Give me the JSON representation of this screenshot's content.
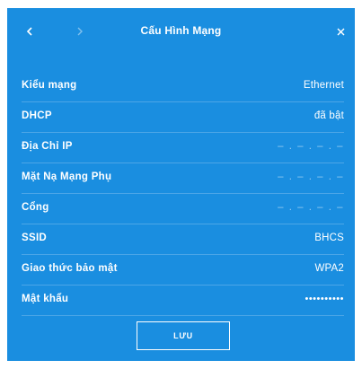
{
  "header": {
    "title": "Cấu Hình Mạng",
    "back_icon": "chevron-left-icon",
    "forward_icon": "chevron-right-icon",
    "close_icon": "close-icon"
  },
  "rows": [
    {
      "label": "Kiểu mạng",
      "value": "Ethernet"
    },
    {
      "label": "DHCP",
      "value": "đã bật"
    },
    {
      "label": "Địa Chỉ IP",
      "value": "– . – . – . –"
    },
    {
      "label": "Mặt Nạ Mạng Phụ",
      "value": "– . – . – . –"
    },
    {
      "label": "Cổng",
      "value": "– . – . – . –"
    },
    {
      "label": "SSID",
      "value": "BHCS"
    },
    {
      "label": "Giao thức bảo mật",
      "value": "WPA2"
    },
    {
      "label": "Mật khẩu",
      "value": "••••••••••"
    }
  ],
  "save_label": "LƯU",
  "colors": {
    "background": "#1a8ee0",
    "text": "#ffffff"
  }
}
